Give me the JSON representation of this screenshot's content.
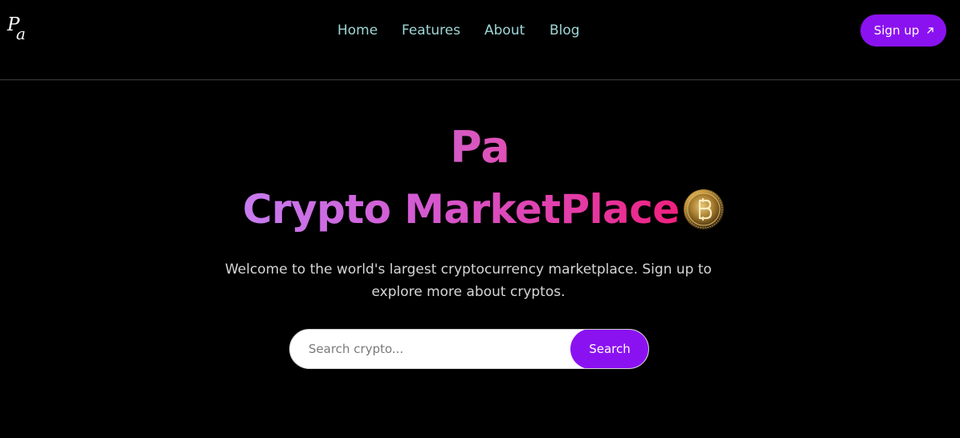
{
  "header": {
    "logo_text_1": "P",
    "logo_text_2": "a",
    "nav": [
      {
        "label": "Home"
      },
      {
        "label": "Features"
      },
      {
        "label": "About"
      },
      {
        "label": "Blog"
      }
    ],
    "signup_label": "Sign up",
    "signup_icon": "arrow-up-right-icon"
  },
  "hero": {
    "line1": "Pa",
    "line2": "Crypto MarketPlace",
    "coin_icon": "bitcoin-coin-icon",
    "subtitle": "Welcome to the world's largest cryptocurrency marketplace. Sign up to explore more about cryptos."
  },
  "search": {
    "placeholder": "Search crypto...",
    "value": "",
    "button_label": "Search"
  },
  "colors": {
    "background": "#000000",
    "accent": "#8b12f0",
    "nav_text": "#9fd6d6",
    "divider": "#3d3d3d",
    "gradient_start": "#c77cf0",
    "gradient_end": "#f0207e"
  }
}
